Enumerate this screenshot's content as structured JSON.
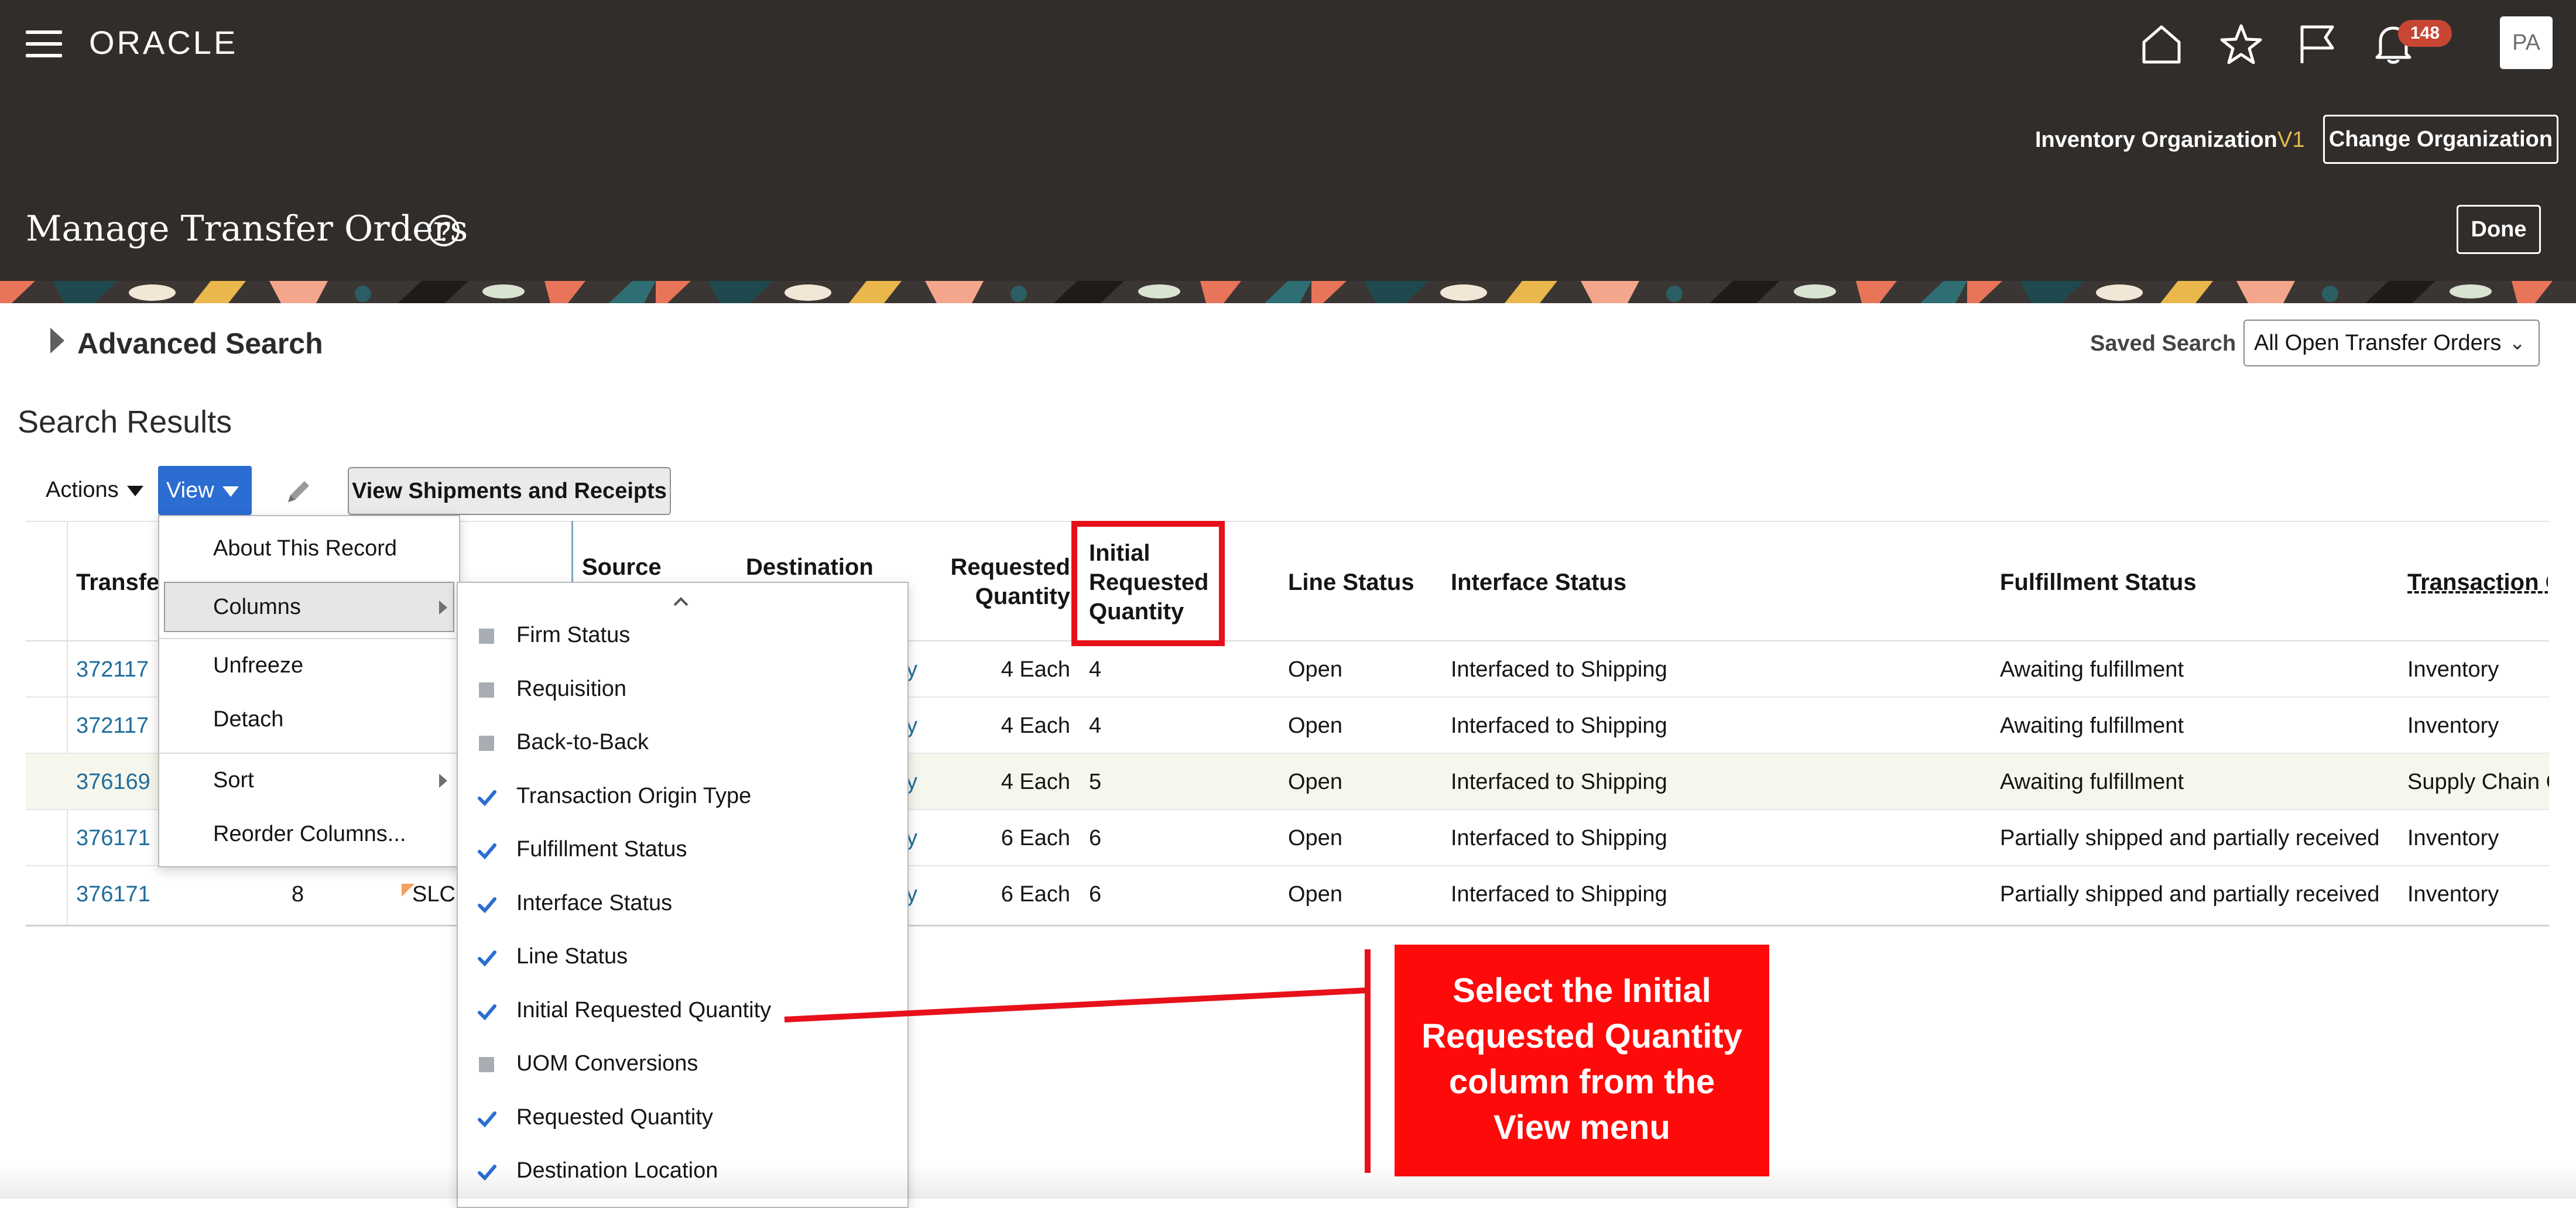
{
  "app": {
    "brand": "ORACLE",
    "notification_count": "148",
    "avatar_initials": "PA",
    "icons": [
      "menu-icon",
      "home-icon",
      "star-icon",
      "flag-icon",
      "bell-icon"
    ]
  },
  "org": {
    "label": "Inventory Organization",
    "value": "V1",
    "change_button": "Change Organization"
  },
  "page": {
    "title": "Manage Transfer Orders",
    "done_button": "Done"
  },
  "search": {
    "advanced_title": "Advanced Search",
    "saved_label": "Saved Search",
    "saved_value": "All Open Transfer Orders"
  },
  "results": {
    "title": "Search Results",
    "toolbar": {
      "actions": "Actions",
      "view": "View",
      "view_shipments": "View Shipments and Receipts"
    },
    "columns": {
      "transfer": "Transfe",
      "source": "Source",
      "destination": "Destination",
      "requested_qty_1": "Requested",
      "requested_qty_2": "Quantity",
      "initial_1": "Initial",
      "initial_2": "Requested",
      "initial_3": "Quantity",
      "line_status": "Line Status",
      "interface_status": "Interface Status",
      "fulfillment_status": "Fulfillment Status",
      "transaction": "Transaction O"
    },
    "rows": [
      {
        "transfer": "372117",
        "dest_tail": "y",
        "req": "4 Each",
        "initial": "4",
        "line_status": "Open",
        "interface": "Interfaced to Shipping",
        "fulfillment": "Awaiting fulfillment",
        "transaction": "Inventory"
      },
      {
        "transfer": "372117",
        "dest_tail": "y",
        "req": "4 Each",
        "initial": "4",
        "line_status": "Open",
        "interface": "Interfaced to Shipping",
        "fulfillment": "Awaiting fulfillment",
        "transaction": "Inventory"
      },
      {
        "transfer": "376169",
        "dest_tail": "y",
        "req": "4 Each",
        "initial": "5",
        "line_status": "Open",
        "interface": "Interfaced to Shipping",
        "fulfillment": "Awaiting fulfillment",
        "transaction": "Supply Chain O"
      },
      {
        "transfer": "376171",
        "dest_tail": "y",
        "req": "6 Each",
        "initial": "6",
        "line_status": "Open",
        "interface": "Interfaced to Shipping",
        "fulfillment": "Partially shipped and partially received",
        "transaction": "Inventory"
      },
      {
        "transfer": "376171",
        "line": "8",
        "source": "SLC",
        "dest_tail": "y",
        "req": "6 Each",
        "initial": "6",
        "line_status": "Open",
        "interface": "Interfaced to Shipping",
        "fulfillment": "Partially shipped and partially received",
        "transaction": "Inventory"
      }
    ]
  },
  "view_menu": {
    "items": [
      "About This Record",
      "Columns",
      "Unfreeze",
      "Detach",
      "Sort",
      "Reorder Columns..."
    ],
    "columns_submenu": [
      {
        "label": "Firm Status",
        "checked": false
      },
      {
        "label": "Requisition",
        "checked": false
      },
      {
        "label": "Back-to-Back",
        "checked": false
      },
      {
        "label": "Transaction Origin Type",
        "checked": true
      },
      {
        "label": "Fulfillment Status",
        "checked": true
      },
      {
        "label": "Interface Status",
        "checked": true
      },
      {
        "label": "Line Status",
        "checked": true
      },
      {
        "label": "Initial Requested Quantity",
        "checked": true
      },
      {
        "label": "UOM Conversions",
        "checked": false
      },
      {
        "label": "Requested Quantity",
        "checked": true
      },
      {
        "label": "Destination Location",
        "checked": true
      }
    ]
  },
  "callout": {
    "line1": "Select the Initial",
    "line2": "Requested Quantity",
    "line3": "column from the",
    "line4": "View menu"
  },
  "colors": {
    "header_bg": "#312d2a",
    "accent_blue": "#2b6dd1",
    "link": "#1f6d9c",
    "callout_red": "#ff0a0a",
    "badge_red": "#c74634",
    "org_value": "#e6b94c"
  }
}
